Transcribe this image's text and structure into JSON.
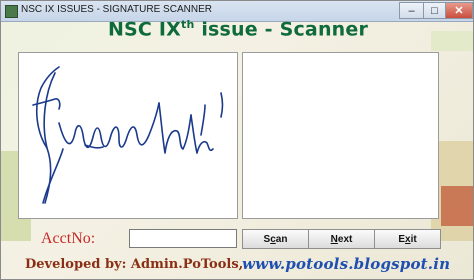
{
  "window": {
    "title": "NSC IX ISSUES - SIGNATURE SCANNER",
    "minimize_glyph": "–",
    "maximize_glyph": "□",
    "close_glyph": "✕"
  },
  "header": {
    "title_prefix": "NSC IX",
    "title_superscript": "th",
    "title_suffix": " issue - Scanner"
  },
  "form": {
    "acct_label": "AcctNo:",
    "acct_value": "",
    "scan_label_pre": "S",
    "scan_label_ul": "c",
    "scan_label_post": "an",
    "next_label_ul": "N",
    "next_label_post": "ext",
    "exit_label_pre": "E",
    "exit_label_ul": "x",
    "exit_label_post": "it"
  },
  "footer": {
    "developer": "Developed by: Admin.PoTools,",
    "website": "www.potools.blogspot.in"
  },
  "colors": {
    "title_green": "#0f6b3a",
    "signature_ink": "#1b3a8c",
    "label_red": "#c62a2a",
    "link_blue": "#1f4fb0"
  }
}
